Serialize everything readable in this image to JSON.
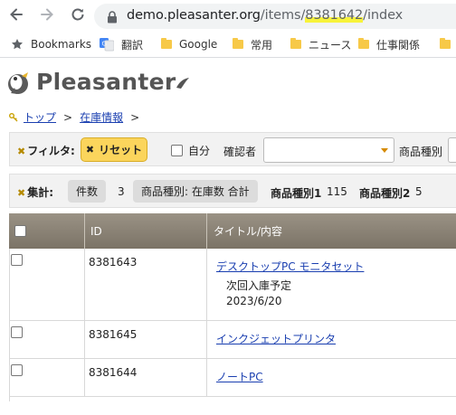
{
  "browser": {
    "url_host": "demo.pleasanter.org",
    "url_path_pre": "/items/",
    "url_id": "8381642",
    "url_path_post": "/index"
  },
  "bookmarks": [
    {
      "label": "Bookmarks",
      "icon": "star-icon"
    },
    {
      "label": "翻訳",
      "icon": "google-translate-icon"
    },
    {
      "label": "Google",
      "icon": "folder-icon"
    },
    {
      "label": "常用",
      "icon": "folder-icon"
    },
    {
      "label": "ニュース",
      "icon": "folder-icon"
    },
    {
      "label": "仕事関係",
      "icon": "folder-icon"
    }
  ],
  "app": {
    "logo_text": "Pleasanter"
  },
  "breadcrumb": {
    "home": "トップ",
    "sep": ">",
    "section": "在庫情報"
  },
  "filter": {
    "label": "フィルタ:",
    "reset_label": "リセット",
    "self_label": "自分",
    "confirmer_label": "確認者",
    "confirmer_value": "",
    "product_type_label": "商品種別"
  },
  "aggregate": {
    "label": "集計:",
    "count_chip": "件数",
    "count_value": "3",
    "sum_chip": "商品種別: 在庫数 合計",
    "type1_label": "商品種別1",
    "type1_value": "115",
    "type2_label": "商品種別2",
    "type2_value": "5"
  },
  "grid": {
    "headers": {
      "id": "ID",
      "title": "タイトル/内容"
    },
    "rows": [
      {
        "id": "8381643",
        "title": "デスクトップPC モニタセット",
        "desc_line1": "次回入庫予定",
        "desc_line2": "2023/6/20"
      },
      {
        "id": "8381645",
        "title": "インクジェットプリンタ",
        "desc_line1": "",
        "desc_line2": ""
      },
      {
        "id": "8381644",
        "title": "ノートPC",
        "desc_line1": "",
        "desc_line2": ""
      }
    ]
  },
  "colors": {
    "highlight": "#f7f33a",
    "reset_button": "#fbd55c",
    "grid_header": "#8a8275",
    "link": "#1a3fb0"
  }
}
